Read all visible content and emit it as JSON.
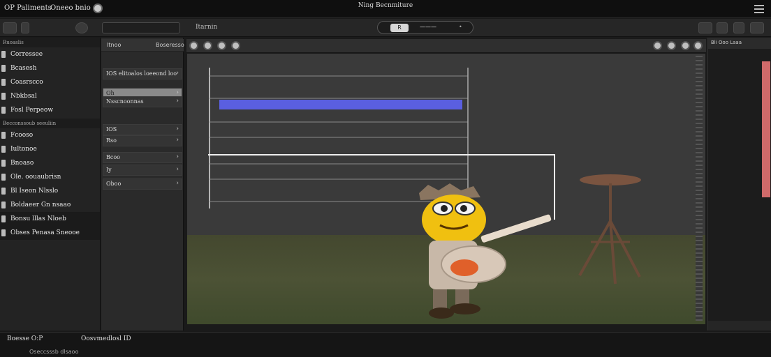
{
  "titlebar": {
    "app_name": "OP Paliments",
    "menu_item": "Oneeo bnio",
    "window_title": "Ning Becnmiture"
  },
  "toolbar": {
    "left_label": "Itarnin",
    "segment_pill": "R",
    "segment_mid": "———",
    "segment_right": "•"
  },
  "left_panel": {
    "section_top": "Ruoaslis",
    "top_items": [
      {
        "label": "Corressee",
        "icon": "doc-icon"
      },
      {
        "label": "Bcasesh",
        "icon": "doc-icon"
      },
      {
        "label": "Coasrscco",
        "icon": "doc-icon"
      },
      {
        "label": "Nbkbsal",
        "icon": "doc-icon"
      },
      {
        "label": "Fosl Perpeow",
        "icon": "doc-icon"
      }
    ],
    "section_mid": "Becconssoub seeuliin",
    "bottom_items": [
      {
        "label": "Fcooso",
        "icon": "doc-icon"
      },
      {
        "label": "Iultonoe",
        "icon": "doc-icon"
      },
      {
        "label": "Bnoaso",
        "icon": "doc-icon"
      },
      {
        "label": "Ole. oouaubrisn",
        "icon": "doc-icon"
      },
      {
        "label": "Bl Iseon Nlsslo",
        "icon": "doc-icon"
      },
      {
        "label": "Boldaeer Gn nsaao",
        "icon": "doc-icon"
      },
      {
        "label": "Bonsu lllas Nloeb",
        "icon": "doc-icon"
      },
      {
        "label": "Obses Penasa Sneooe",
        "icon": "doc-icon"
      }
    ]
  },
  "mid_panel": {
    "header_left": "Itnoo",
    "header_right": "Boseresso",
    "rows": [
      {
        "label": "IOS elitoalos loeeond loo",
        "style": "dark"
      },
      {
        "label": "Oh",
        "style": "light"
      },
      {
        "label": "Nsscnoonnas",
        "style": "dark"
      },
      {
        "label": "IOS",
        "style": "dark"
      },
      {
        "label": "Rso",
        "style": "dark"
      },
      {
        "label": "Bcoo",
        "style": "dark"
      },
      {
        "label": "Iy",
        "style": "dark"
      },
      {
        "label": "Oboo",
        "style": "dark"
      }
    ]
  },
  "viewport": {
    "accent_bar_color": "#5a5fe0",
    "scene": "cartoon-character-with-guitar"
  },
  "right_panel": {
    "header": "Bli Ooo Laaa",
    "accent_color": "#d06a6a"
  },
  "bottom": {
    "status_left": "Boesse O:P",
    "status_mid": "Oosvmedlosl ID",
    "footer": "Oseccsssb dlsaoo"
  }
}
